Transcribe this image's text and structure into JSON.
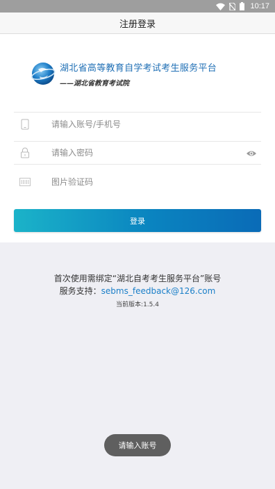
{
  "status_bar": {
    "time": "10:17"
  },
  "header": {
    "title": "注册登录"
  },
  "brand": {
    "title": "湖北省高等教育自学考试考生服务平台",
    "subtitle": "——湖北省教育考试院"
  },
  "form": {
    "account_placeholder": "请输入账号/手机号",
    "password_placeholder": "请输入密码",
    "captcha_placeholder": "图片验证码",
    "login_label": "登录"
  },
  "info": {
    "binding_note": "首次使用需绑定“湖北自考考生服务平台”账号",
    "support_label": "服务支持：",
    "support_email": "sebms_feedback@126.com",
    "version": "当前版本:1.5.4"
  },
  "toast": {
    "message": "请输入账号"
  },
  "colors": {
    "accent": "#0a84c0",
    "brand_text": "#1f6fb5",
    "link": "#1a7fc8"
  },
  "icons": [
    "wifi-icon",
    "no-sim-icon",
    "battery-icon",
    "phone-icon",
    "lock-icon",
    "eye-icon",
    "captcha-icon"
  ]
}
